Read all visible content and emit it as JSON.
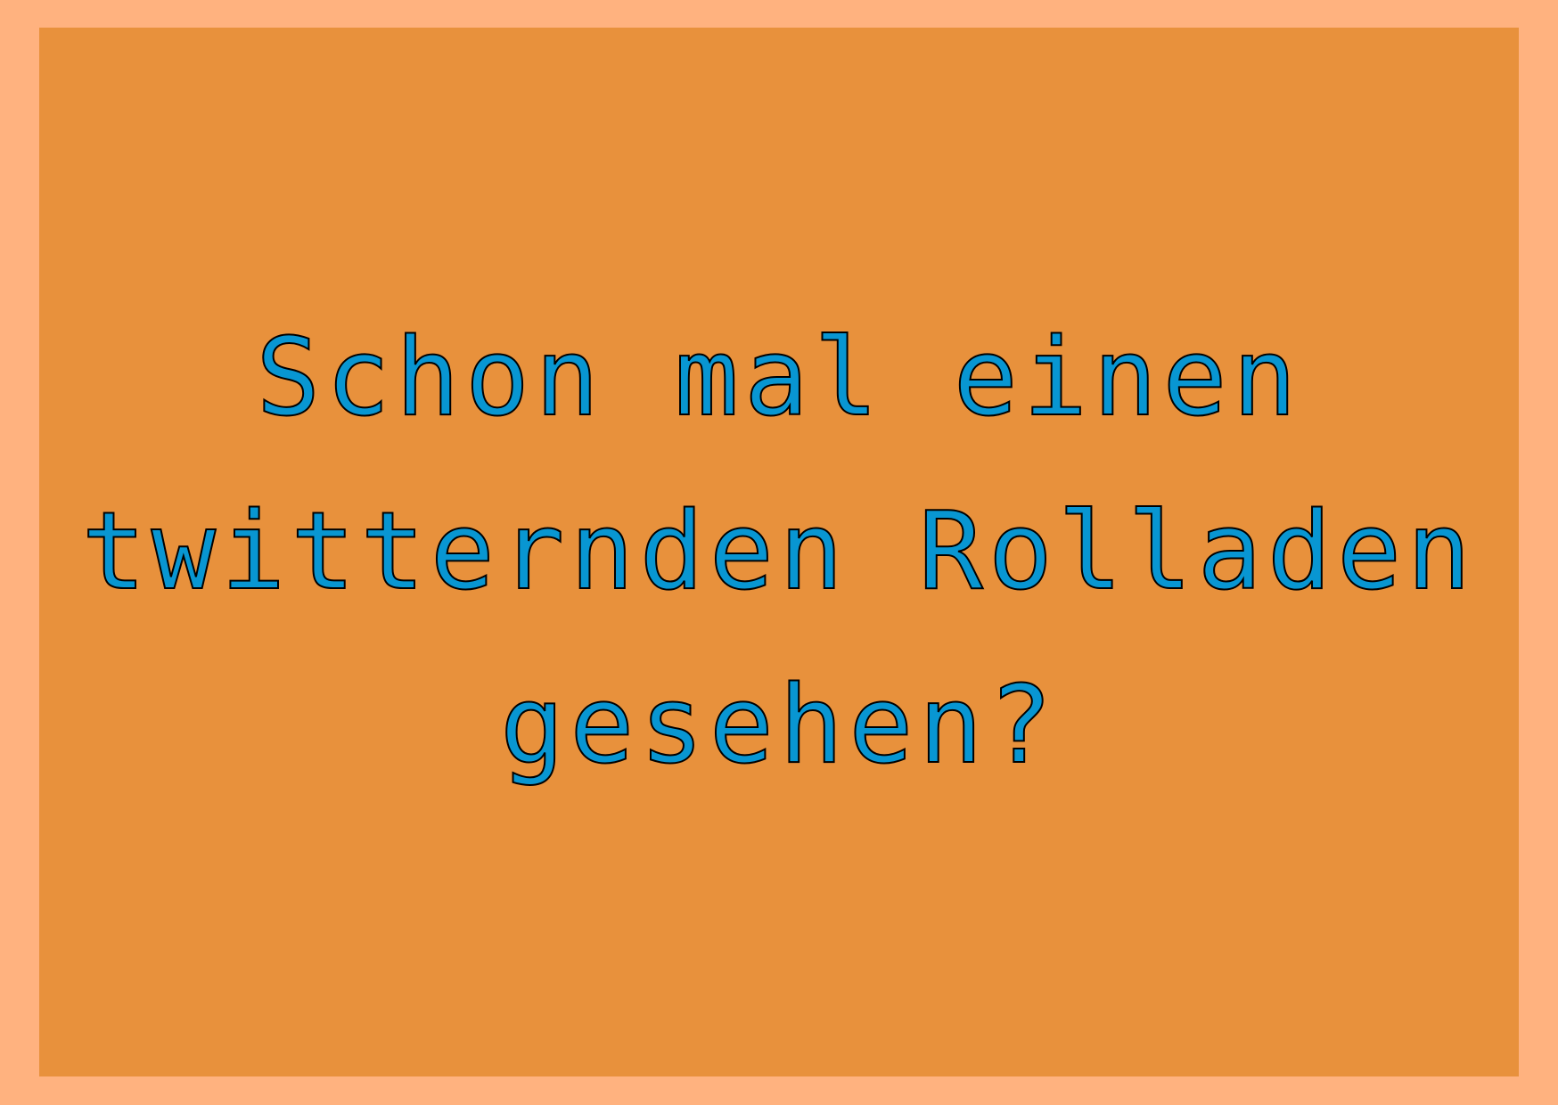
{
  "message": {
    "lines": [
      "Schon mal einen",
      "twitternden Rolladen",
      "gesehen?"
    ]
  },
  "colors": {
    "outer_border": "#FFB27F",
    "card_background": "#E8913C",
    "text_fill": "#0896D2",
    "text_outline": "#000000"
  }
}
